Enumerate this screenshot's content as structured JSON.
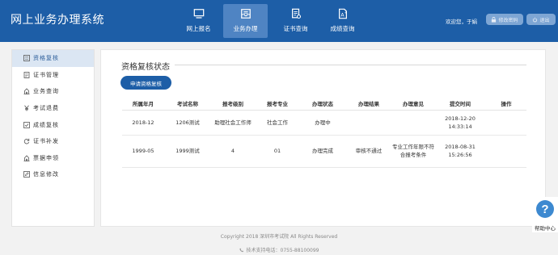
{
  "header": {
    "site_title": "网上业务办理系统",
    "nav": [
      {
        "label": "网上报名",
        "icon": "monitor-icon"
      },
      {
        "label": "业务办理",
        "icon": "inbox-icon",
        "active": true
      },
      {
        "label": "证书查询",
        "icon": "certificate-icon"
      },
      {
        "label": "成绩查询",
        "icon": "grade-icon"
      }
    ],
    "welcome": "欢迎您，于娟",
    "change_password": "修改密码",
    "logout": "退出"
  },
  "sidebar": {
    "items": [
      {
        "label": "资格复核",
        "icon": "list-icon",
        "active": true
      },
      {
        "label": "证书管理",
        "icon": "document-icon"
      },
      {
        "label": "业务查询",
        "icon": "building-icon"
      },
      {
        "label": "考试退费",
        "icon": "yen-icon"
      },
      {
        "label": "成绩复核",
        "icon": "check-box-icon"
      },
      {
        "label": "证书补发",
        "icon": "refresh-icon"
      },
      {
        "label": "票据申领",
        "icon": "building-icon"
      },
      {
        "label": "信息修改",
        "icon": "edit-icon"
      }
    ]
  },
  "main": {
    "section_title": "资格复核状态",
    "apply_button": "申请资格复核",
    "table": {
      "headers": [
        "所属年月",
        "考试名称",
        "报考级别",
        "报考专业",
        "办理状态",
        "办理结果",
        "办理意见",
        "提交时间",
        "操作"
      ],
      "rows": [
        [
          "2018-12",
          "1206测试",
          "助理社会工作师",
          "社会工作",
          "办理中",
          "",
          "",
          "2018-12-20 14:33:14",
          ""
        ],
        [
          "1999-05",
          "1999测试",
          "4",
          "01",
          "办理完成",
          "审核不通过",
          "专业工作年限不符合报考条件",
          "2018-08-31 15:26:56",
          ""
        ]
      ]
    }
  },
  "footer": {
    "copyright": "Copyright 2018 深圳市考试院 All Rights Reserved",
    "support": "技术支持电话：0755-88100099"
  },
  "help": {
    "label": "帮助中心",
    "symbol": "?"
  },
  "colors": {
    "brand": "#1d5ea7",
    "active_nav": "#4f84c3",
    "sidebar_active": "#dbe6f3"
  }
}
